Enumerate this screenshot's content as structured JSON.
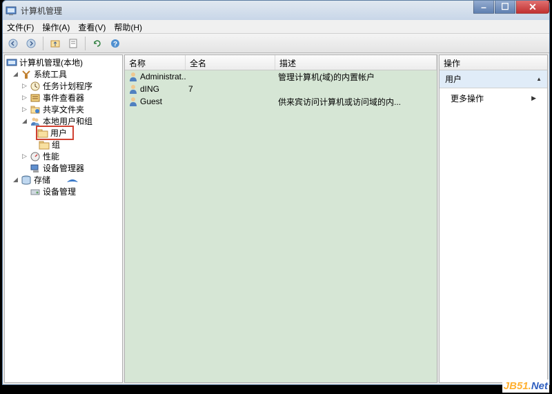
{
  "window": {
    "title": "计算机管理"
  },
  "menu": {
    "file": "文件(F)",
    "action": "操作(A)",
    "view": "查看(V)",
    "help": "帮助(H)"
  },
  "tree": {
    "root": "计算机管理(本地)",
    "sys_tools": "系统工具",
    "task_scheduler": "任务计划程序",
    "event_viewer": "事件查看器",
    "shared_folders": "共享文件夹",
    "local_users_groups": "本地用户和组",
    "users": "用户",
    "groups": "组",
    "performance": "性能",
    "device_manager": "设备管理器",
    "storage": "存储",
    "device_mgmt": "设备管理"
  },
  "columns": {
    "name": "名称",
    "fullname": "全名",
    "desc": "描述"
  },
  "col_widths": {
    "name": 88,
    "fullname": 130,
    "desc": 230
  },
  "users": [
    {
      "name": "Administrat...",
      "fullname": "",
      "desc": "管理计算机(域)的内置帐户"
    },
    {
      "name": "dING",
      "fullname": "7",
      "desc": ""
    },
    {
      "name": "Guest",
      "fullname": "",
      "desc": "供来宾访问计算机或访问域的内..."
    }
  ],
  "actions": {
    "header": "操作",
    "section": "用户",
    "more": "更多操作"
  },
  "watermark": {
    "a": "JB51.",
    "b": "Net"
  }
}
